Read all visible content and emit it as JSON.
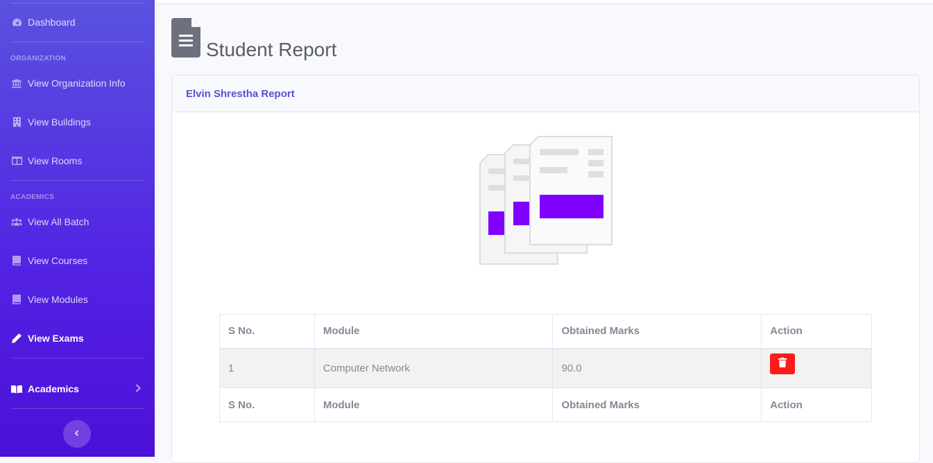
{
  "sidebar": {
    "dashboard": "Dashboard",
    "heading_org": "ORGANIZATION",
    "org_info": "View Organization Info",
    "buildings": "View Buildings",
    "rooms": "View Rooms",
    "heading_academics": "ACADEMICS",
    "all_batch": "View All Batch",
    "courses": "View Courses",
    "modules": "View Modules",
    "exams": "View Exams",
    "academics": "Academics"
  },
  "page": {
    "title": "Student Report"
  },
  "card": {
    "header": "Elvin Shrestha Report"
  },
  "table": {
    "columns": [
      "S No.",
      "Module",
      "Obtained Marks",
      "Action"
    ],
    "rows": [
      {
        "sno": "1",
        "module": "Computer Network",
        "marks": "90.0"
      }
    ]
  },
  "colors": {
    "accent": "#5a4fd6",
    "sidebar_top": "#5a52e0",
    "sidebar_bottom": "#4c10d8",
    "danger": "#ff1a1a",
    "illustration_accent": "#7f00ff"
  }
}
